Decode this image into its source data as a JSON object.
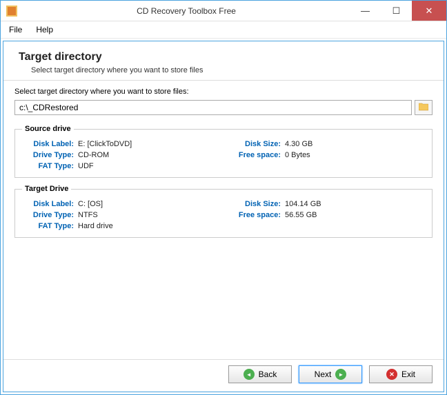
{
  "window": {
    "title": "CD Recovery Toolbox Free"
  },
  "menu": {
    "file": "File",
    "help": "Help"
  },
  "header": {
    "title": "Target directory",
    "subtitle": "Select target directory where you want to store files"
  },
  "content": {
    "label": "Select target directory where you want to store files:",
    "path": "c:\\_CDRestored"
  },
  "source": {
    "legend": "Source drive",
    "disk_label_lbl": "Disk Label:",
    "disk_label_val": "E: [ClickToDVD]",
    "drive_type_lbl": "Drive Type:",
    "drive_type_val": "CD-ROM",
    "fat_type_lbl": "FAT Type:",
    "fat_type_val": "UDF",
    "disk_size_lbl": "Disk Size:",
    "disk_size_val": "4.30 GB",
    "free_space_lbl": "Free space:",
    "free_space_val": "0 Bytes"
  },
  "target": {
    "legend": "Target Drive",
    "disk_label_lbl": "Disk Label:",
    "disk_label_val": "C: [OS]",
    "drive_type_lbl": "Drive Type:",
    "drive_type_val": "NTFS",
    "fat_type_lbl": "FAT Type:",
    "fat_type_val": "Hard drive",
    "disk_size_lbl": "Disk Size:",
    "disk_size_val": "104.14 GB",
    "free_space_lbl": "Free space:",
    "free_space_val": "56.55 GB"
  },
  "buttons": {
    "back": "Back",
    "next": "Next",
    "exit": "Exit"
  }
}
